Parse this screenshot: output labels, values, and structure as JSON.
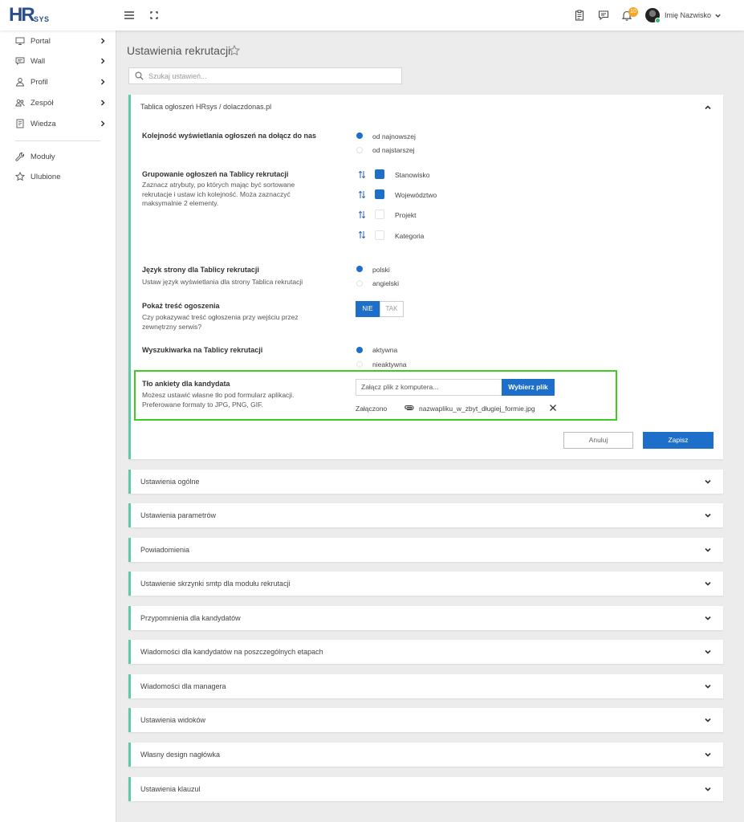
{
  "app": {
    "logo_main": "HR",
    "logo_sub": "SYS"
  },
  "topbar": {
    "notification_count": "10",
    "user_name": "Imię Nazwisko"
  },
  "sidebar": {
    "items": [
      {
        "label": "Portal",
        "icon": "monitor-icon"
      },
      {
        "label": "Wall",
        "icon": "chat-icon"
      },
      {
        "label": "Profil",
        "icon": "user-icon"
      },
      {
        "label": "Zespół",
        "icon": "team-icon"
      },
      {
        "label": "Wiedza",
        "icon": "book-icon"
      },
      {
        "label": "Moduły",
        "icon": "wrench-icon"
      },
      {
        "label": "Ulubione",
        "icon": "star-icon"
      }
    ]
  },
  "page": {
    "title": "Ustawienia rekrutacji",
    "search_placeholder": "Szukaj ustawień..."
  },
  "board_panel": {
    "title": "Tablica ogłoszeń HRsys / dolaczdonas.pl",
    "order": {
      "title": "Kolejność wyświetlania ogłoszeń na dołącz do nas",
      "options": [
        "od najnowszej",
        "od najstarszej"
      ],
      "selected": 0
    },
    "grouping": {
      "title": "Grupowanie ogłoszeń na Tablicy rekrutacji",
      "desc_lines": [
        "Zaznacz atrybuty, po których mając być sortowane",
        "rekrutacje i ustaw ich kolejność. Moża zaznaczyć",
        "maksymalnie 2 elementy."
      ],
      "options": [
        {
          "label": "Stanowisko",
          "checked": true
        },
        {
          "label": "Województwo",
          "checked": true
        },
        {
          "label": "Projekt",
          "checked": false
        },
        {
          "label": "Kategoria",
          "checked": false
        }
      ]
    },
    "language": {
      "title": "Język strony dla Tablicy rekrutacji",
      "desc": "Ustaw język wyświetlania dla strony Tablica rekrutacji",
      "options": [
        "polski",
        "angielski"
      ],
      "selected": 0
    },
    "show_content": {
      "title": "Pokaż treść ogoszenia",
      "desc_lines": [
        "Czy pokazywać treść ogłoszenia przy wejściu przez",
        "zewnętrzny serwis?"
      ],
      "no": "NIE",
      "yes": "TAK",
      "selected": "no"
    },
    "search_engine": {
      "title": "Wyszukiwarka na Tablicy rekrutacji",
      "options": [
        "aktywna",
        "nieaktywna"
      ],
      "selected": 0
    },
    "background": {
      "title": "Tło ankiety dla kandydata",
      "desc_lines": [
        "Możesz ustawić własne tło pod formularz aplikacji.",
        "Preferowane formaty to JPG, PNG, GIF."
      ],
      "file_placeholder": "Załącz plik z komputera...",
      "choose_button": "Wybierz plik",
      "attached_label": "Załączono",
      "file_name": "nazwapliku_w_zbyt_długiej_formie.jpg"
    },
    "cancel_button": "Anuluj",
    "save_button": "Zapisz"
  },
  "sections": [
    "Ustawienia ogólne",
    "Ustawienia parametrów",
    "Powiadomienia",
    "Ustawienie skrzynki smtp dla modułu rekrutacji",
    "Przypomnienia dla kandydatów",
    "Wiadomości dla kandydatów na poszczególnych etapach",
    "Wiadomości dla managera",
    "Ustawienia widoków",
    "Własny design nagłówka",
    "Ustawienia klauzul"
  ],
  "colors": {
    "accent": "#1e6fc9",
    "panel_border": "#5ec9a5",
    "highlight": "#3ecb24",
    "badge": "#f5a623"
  }
}
